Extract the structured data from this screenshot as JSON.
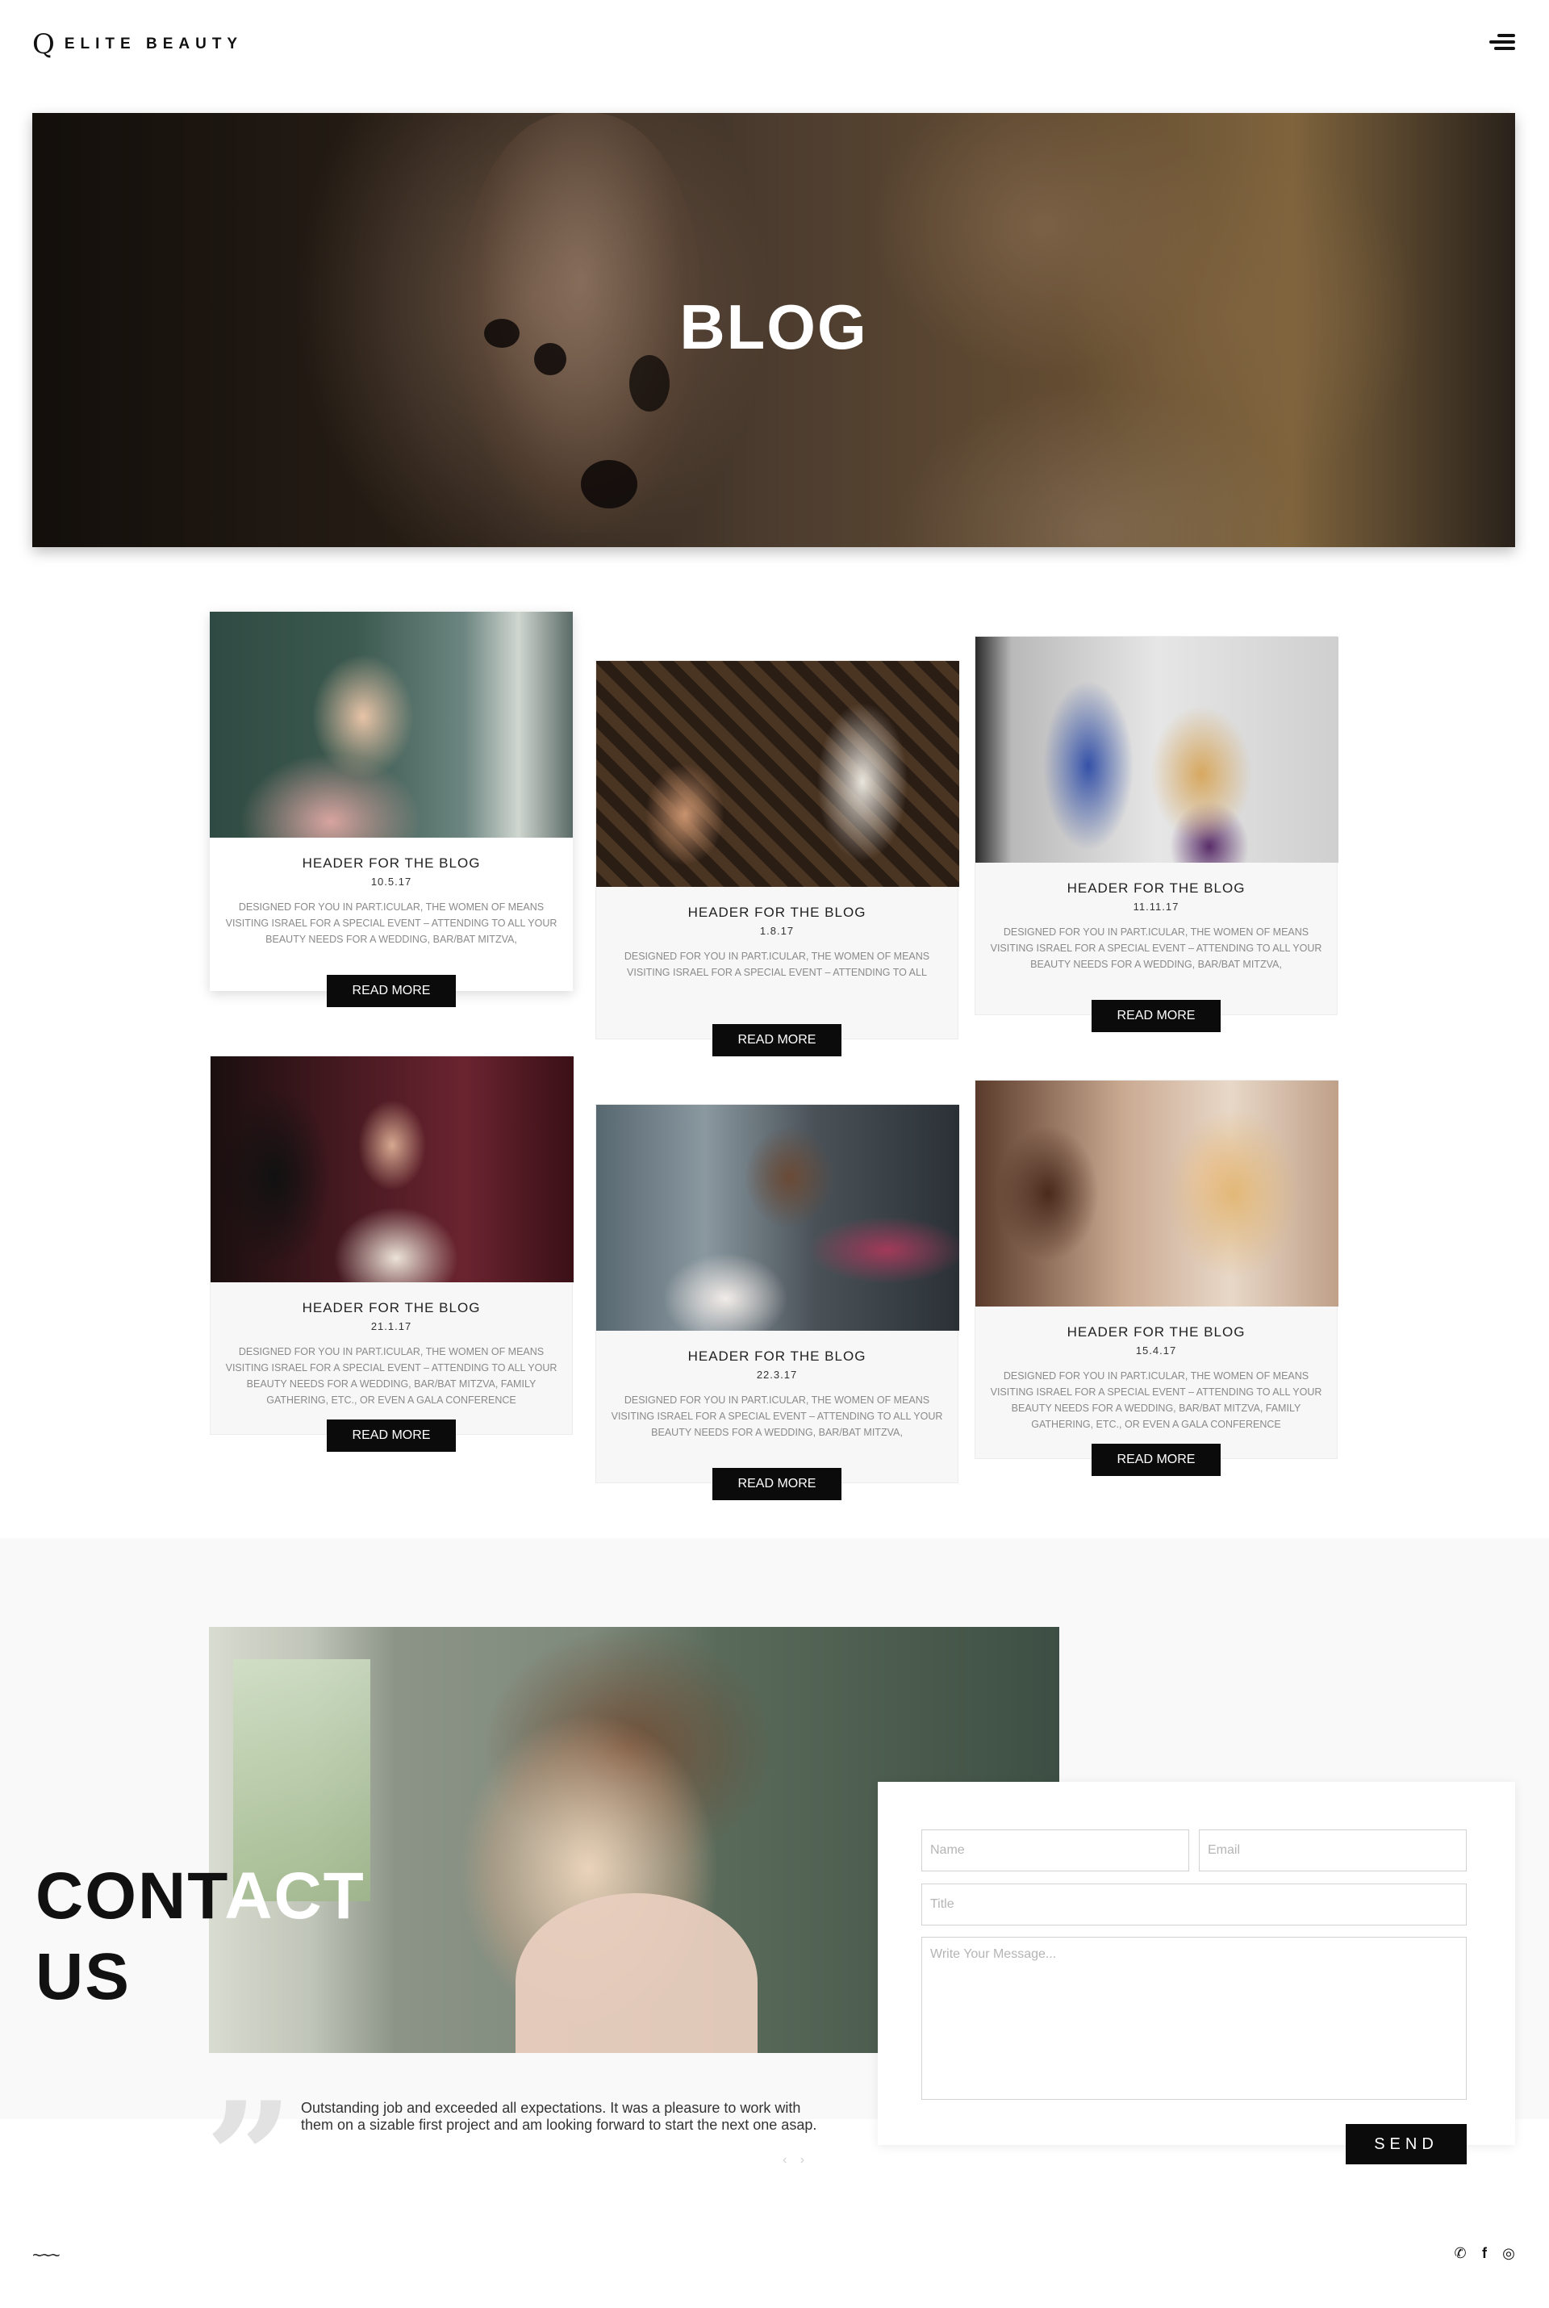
{
  "header": {
    "logo_mark": "Q",
    "logo_text": "ELITE BEAUTY",
    "menu_icon": "hamburger-menu-icon"
  },
  "hero": {
    "title": "BLOG"
  },
  "blog": {
    "read_more_label": "READ MORE",
    "cards": [
      {
        "title": "HEADER FOR THE BLOG",
        "date": "10.5.17",
        "text": "DESIGNED FOR YOU IN PART.ICULAR, THE WOMEN OF MEANS VISITING ISRAEL FOR A SPECIAL EVENT – ATTENDING TO ALL YOUR BEAUTY NEEDS FOR A WEDDING, BAR/BAT MITZVA,"
      },
      {
        "title": "HEADER FOR THE BLOG",
        "date": "1.8.17",
        "text": "DESIGNED FOR YOU IN PART.ICULAR, THE WOMEN OF MEANS VISITING ISRAEL FOR A SPECIAL EVENT – ATTENDING TO ALL"
      },
      {
        "title": "HEADER FOR THE BLOG",
        "date": "11.11.17",
        "text": "DESIGNED FOR YOU IN PART.ICULAR, THE WOMEN OF MEANS VISITING ISRAEL FOR A SPECIAL EVENT – ATTENDING TO ALL YOUR BEAUTY NEEDS FOR A WEDDING, BAR/BAT MITZVA,"
      },
      {
        "title": "HEADER FOR THE BLOG",
        "date": "21.1.17",
        "text": "DESIGNED FOR YOU IN PART.ICULAR, THE WOMEN OF MEANS VISITING ISRAEL FOR A SPECIAL EVENT – ATTENDING TO ALL YOUR BEAUTY NEEDS FOR A WEDDING, BAR/BAT MITZVA, FAMILY GATHERING, ETC., OR EVEN A GALA CONFERENCE"
      },
      {
        "title": "HEADER FOR THE BLOG",
        "date": "22.3.17",
        "text": "DESIGNED FOR YOU IN PART.ICULAR, THE WOMEN OF MEANS VISITING ISRAEL FOR A SPECIAL EVENT – ATTENDING TO ALL YOUR BEAUTY NEEDS FOR A WEDDING, BAR/BAT MITZVA,"
      },
      {
        "title": "HEADER FOR THE BLOG",
        "date": "15.4.17",
        "text": "DESIGNED FOR YOU IN PART.ICULAR, THE WOMEN OF MEANS VISITING ISRAEL FOR A SPECIAL EVENT – ATTENDING TO ALL YOUR BEAUTY NEEDS FOR A WEDDING, BAR/BAT MITZVA, FAMILY GATHERING, ETC., OR EVEN A GALA CONFERENCE"
      }
    ]
  },
  "contact": {
    "title_line1_dark": "CONT",
    "title_line1_light": "ACT",
    "title_line2": "US",
    "form": {
      "name_placeholder": "Name",
      "email_placeholder": "Email",
      "title_placeholder": "Title",
      "message_placeholder": "Write Your Message...",
      "send_label": "SEND"
    },
    "testimonial": {
      "quote_mark": "”",
      "text": "Outstanding job and exceeded all expectations. It was a pleasure to work with them on a sizable first project and am looking forward to start the next one asap.",
      "arrows": "‹ ›"
    }
  },
  "footer": {
    "wave": "~~~",
    "social": [
      {
        "icon": "whatsapp-icon",
        "glyph": "✆"
      },
      {
        "icon": "facebook-icon",
        "glyph": "f"
      },
      {
        "icon": "instagram-icon",
        "glyph": "◎"
      }
    ]
  },
  "colors": {
    "accent": "#0b0b0b",
    "band": "#f9f9f9",
    "card_bg": "#f7f7f7"
  }
}
